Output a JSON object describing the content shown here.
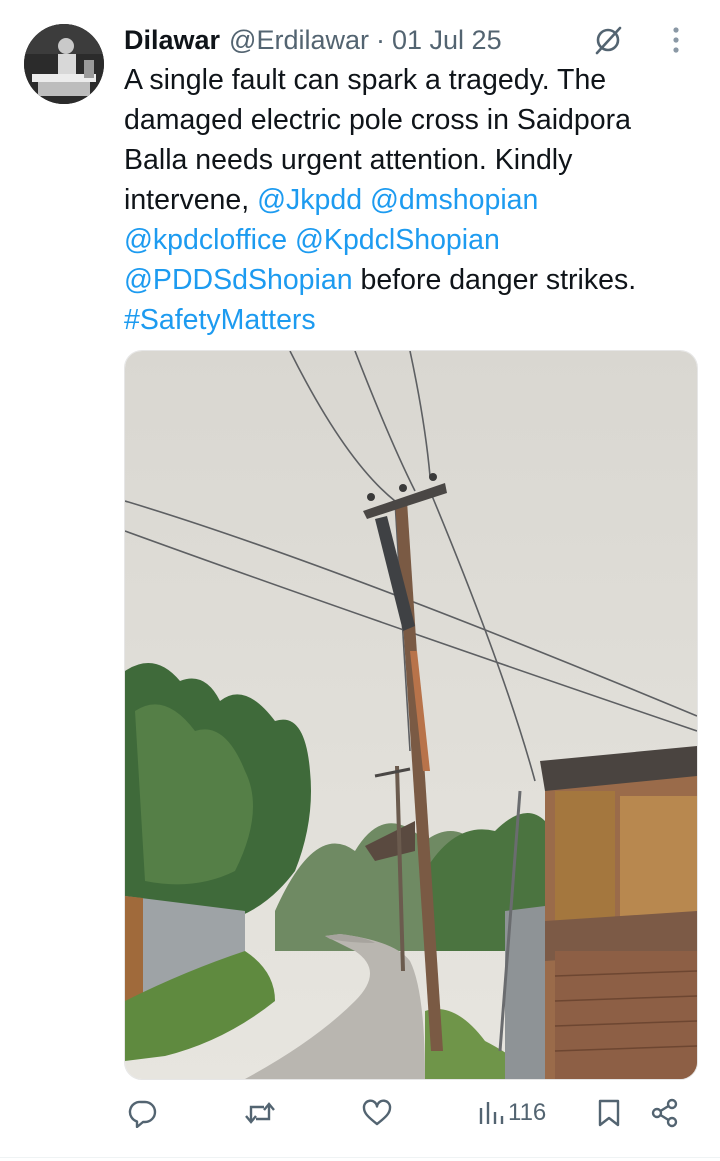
{
  "tweet": {
    "author_name": "Dilawar",
    "author_handle": "@Erdilawar",
    "separator": "·",
    "date": "01 Jul 25",
    "text_1": "A single fault can spark a tragedy. The damaged electric pole cross in Saidpora Balla needs urgent attention. Kindly intervene, ",
    "mention_1": "@Jkpdd",
    "mention_2": "@dmshopian",
    "mention_3": "@kpdcloffice",
    "mention_4": "@KpdclShopian",
    "mention_5": "@PDDSdShopian",
    "text_2": " before danger strikes.",
    "hashtag": "#SafetyMatters"
  },
  "actions": {
    "views": "116"
  },
  "icons": {
    "grok": "grok-icon",
    "more": "more-vertical-icon",
    "reply": "reply-icon",
    "retweet": "retweet-icon",
    "like": "like-icon",
    "views": "views-icon",
    "bookmark": "bookmark-icon",
    "share": "share-icon"
  },
  "colors": {
    "link": "#1d9bf0",
    "secondary_text": "#536471",
    "primary_text": "#0f1419"
  }
}
